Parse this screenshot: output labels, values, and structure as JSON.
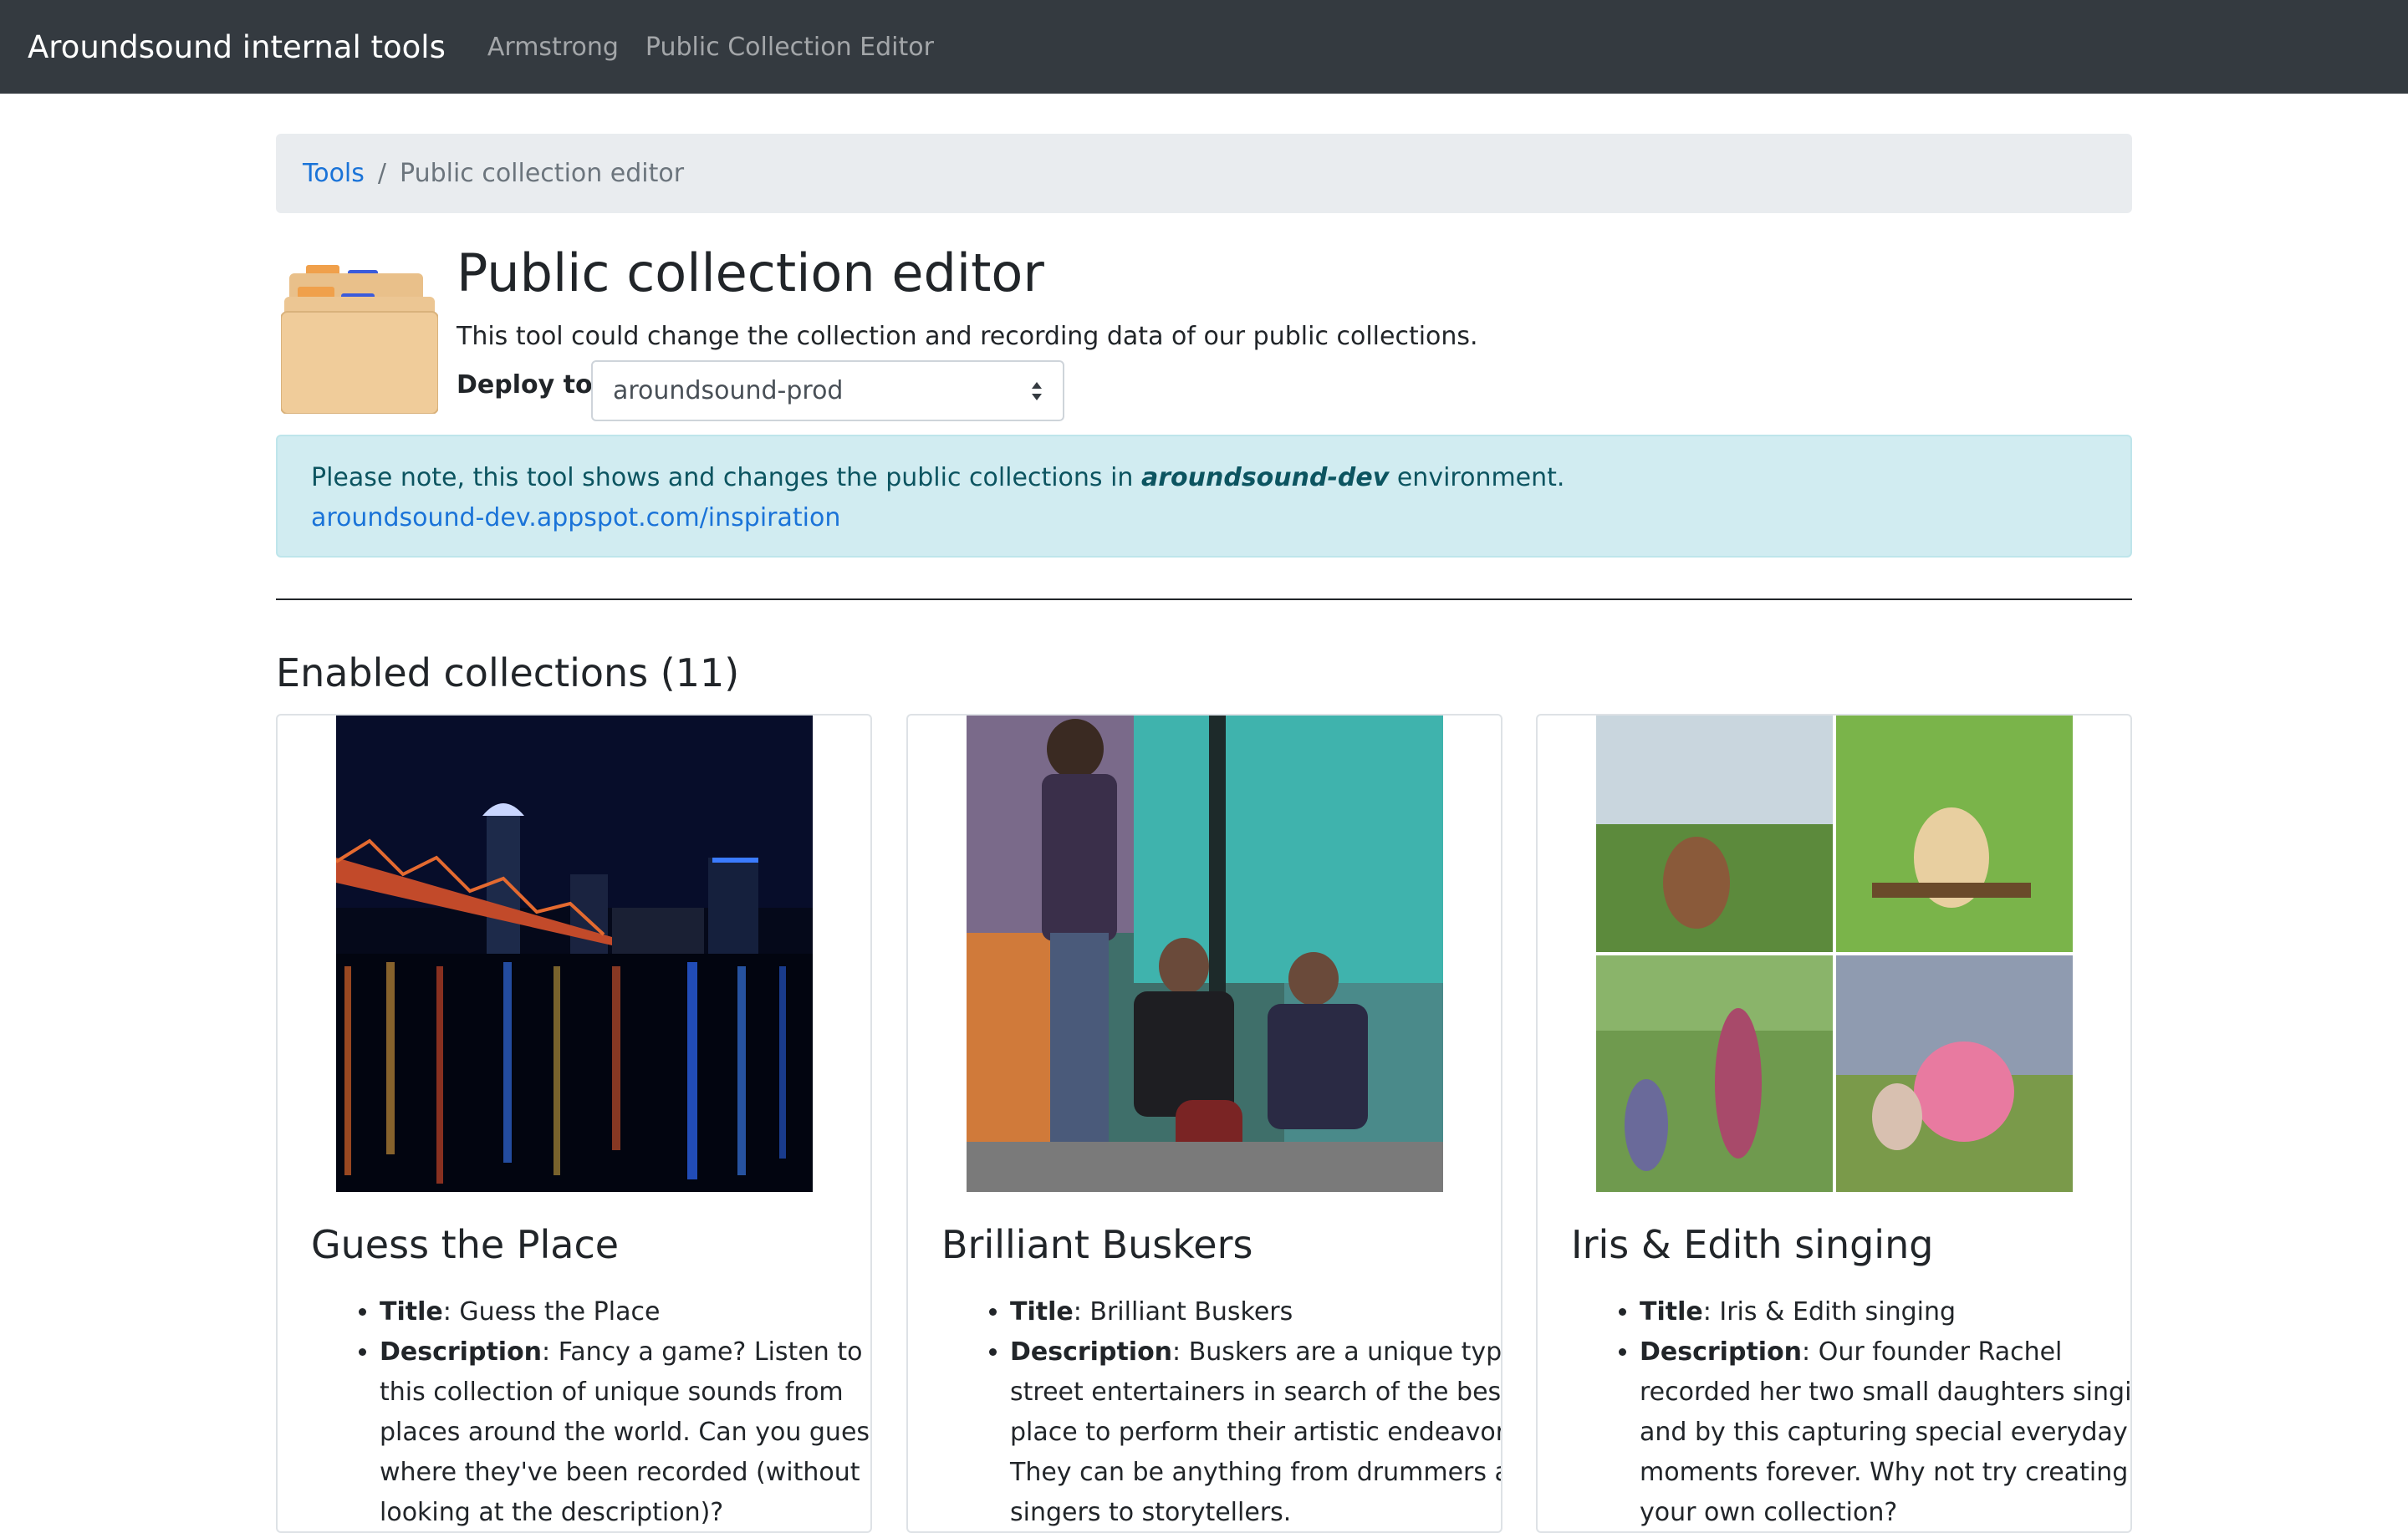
{
  "navbar": {
    "brand": "Aroundsound internal tools",
    "links": [
      "Armstrong",
      "Public Collection Editor"
    ]
  },
  "breadcrumb": {
    "link": "Tools",
    "separator": "/",
    "current": "Public collection editor"
  },
  "header": {
    "icon": "file-cabinet-icon",
    "title": "Public collection editor",
    "description": "This tool could change the collection and recording data of our public collections.",
    "deploy_label": "Deploy to:",
    "deploy_value": "aroundsound-prod"
  },
  "alert": {
    "text_before": "Please note, this tool shows and changes the public collections in ",
    "env": "aroundsound-dev",
    "text_after": " environment.",
    "link": "aroundsound-dev.appspot.com/inspiration"
  },
  "collections": {
    "heading": "Enabled collections (11)",
    "title_label": "Title",
    "description_label": "Description",
    "items": [
      {
        "name": "Guess the Place",
        "title": "Guess the Place",
        "description": "Fancy a game? Listen to this collection of unique sounds from places around the world. Can you guess where they've been recorded (without looking at the description)?"
      },
      {
        "name": "Brilliant Buskers",
        "title": "Brilliant Buskers",
        "description": "Buskers are a unique type street entertainers in search of the best place to perform their artistic endeavor. They can be anything from drummers and singers to storytellers."
      },
      {
        "name": "Iris & Edith singing",
        "title": "Iris & Edith singing",
        "description": "Our founder Rachel recorded her two small daughters singing and by this capturing special everyday moments forever. Why not try creating your own collection?"
      }
    ]
  },
  "colors": {
    "navbar": "#343a40",
    "link": "#1a73d8",
    "alert_bg": "#d1ecf1",
    "alert_text": "#0c5460"
  }
}
